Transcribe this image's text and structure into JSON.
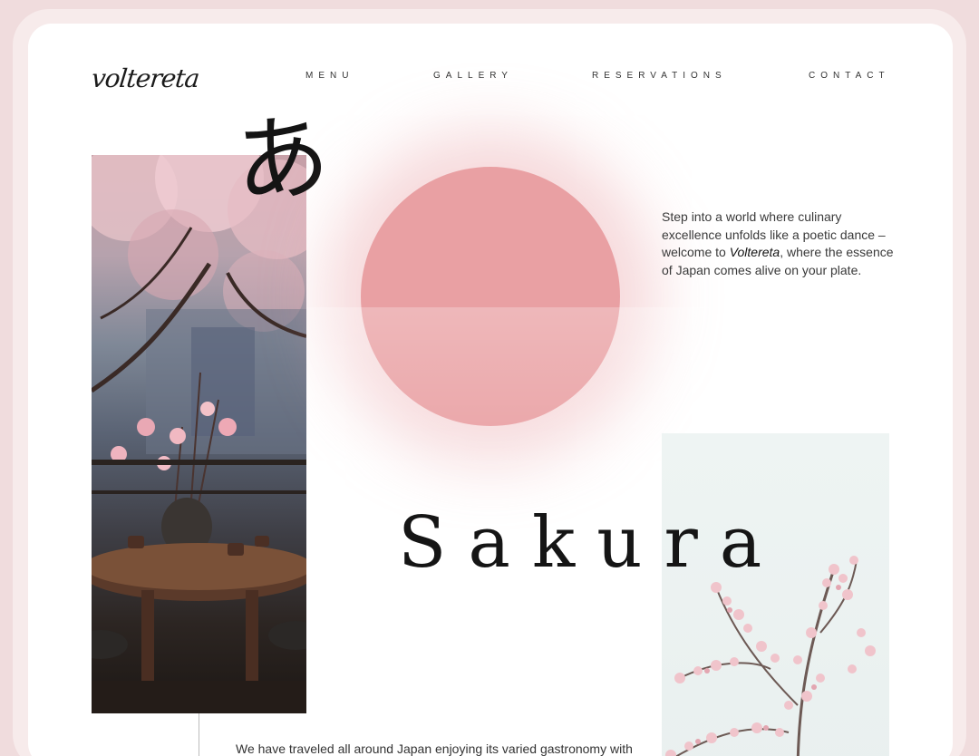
{
  "brand": {
    "logo_text": "voltereta"
  },
  "nav": {
    "items": [
      {
        "label": "MENU"
      },
      {
        "label": "GALLERY"
      },
      {
        "label": "RESERVATIONS"
      },
      {
        "label": "CONTACT"
      }
    ]
  },
  "hero": {
    "kana": "あ",
    "title": "Sakura",
    "intro_before": "Step into a world where culinary excellence unfolds like a poetic dance – welcome to ",
    "intro_brand": "Voltereta",
    "intro_after": ", where the essence of Japan comes alive on your plate."
  },
  "story": {
    "text": "We have traveled all around Japan enjoying its varied gastronomy with"
  },
  "colors": {
    "sun": "#e9a0a3",
    "background": "#f0dcdd",
    "card": "#ffffff",
    "text": "#151515"
  },
  "images": {
    "left_photo": "cherry-blossom-tea-table-photo",
    "right_photo": "cherry-blossom-branch-photo"
  }
}
